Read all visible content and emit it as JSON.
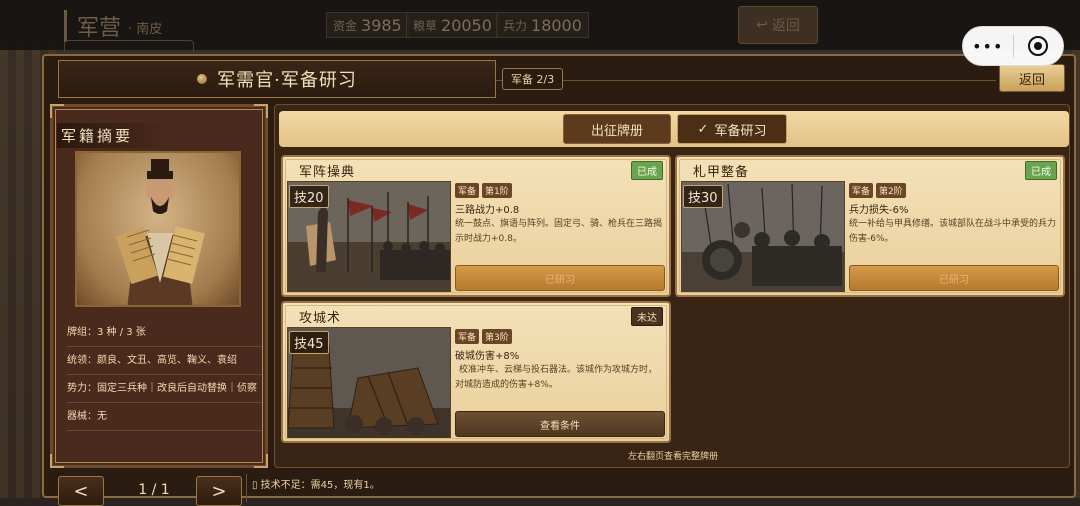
{
  "hud": {
    "title": "军营",
    "subtitle": "· 南皮",
    "resources": [
      {
        "label": "资金",
        "value": "3985"
      },
      {
        "label": "粮草",
        "value": "20050"
      },
      {
        "label": "兵力",
        "value": "18000"
      }
    ],
    "back": "返回"
  },
  "capsule": {
    "more": "•••"
  },
  "modal": {
    "title": "军需官·军备研习",
    "counter": "军备 2/3",
    "back": "返回"
  },
  "summary": {
    "title": "军籍摘要",
    "rows": [
      "牌组：3 种 / 3 张",
      "统领：颜良、文丑、高览、鞠义、袁绍",
      "势力：固定三兵种｜改良后自动替换｜侦察",
      "器械：无"
    ]
  },
  "tabs": [
    {
      "label": "出征牌册",
      "check": ""
    },
    {
      "label": "军备研习",
      "check": "✓"
    }
  ],
  "cards": [
    {
      "name": "军阵操典",
      "status": "已成",
      "tech": "技20",
      "tags": [
        "军备",
        "第1阶"
      ],
      "effect": "三路战力+0.8",
      "desc": "统一鼓点、旗语与阵列。固定弓、骑、枪兵在三路揭示时战力+0.8。",
      "button": "已研习"
    },
    {
      "name": "札甲整备",
      "status": "已成",
      "tech": "技30",
      "tags": [
        "军备",
        "第2阶"
      ],
      "effect": "兵力损失-6%",
      "desc": "统一补给与甲具修缮。该城部队在战斗中承受的兵力伤害-6%。",
      "button": "已研习"
    },
    {
      "name": "攻城术",
      "status": "未达",
      "tech": "技45",
      "tags": [
        "军备",
        "第3阶"
      ],
      "effect": "破城伤害+8%",
      "desc": "校准冲车、云梯与投石器法。该城作为攻城方时，对城防造成的伤害+8%。",
      "button": "查看条件"
    }
  ],
  "page_hint": "左右翻页查看完整牌册",
  "pager": {
    "prev": "<",
    "next": ">",
    "page": "1 / 1"
  },
  "warning": "▯ 技术不足：需45，现有1。"
}
